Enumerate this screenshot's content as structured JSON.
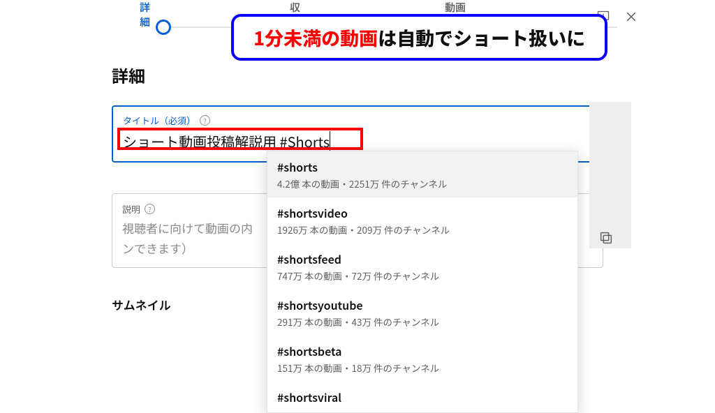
{
  "stepper": {
    "tabs": [
      "詳細",
      "収益化",
      "動画の要素"
    ],
    "active": 0
  },
  "section_title": "詳細",
  "title_field": {
    "label": "タイトル（必須）",
    "value": "ショート動画投稿解説用 #Shorts"
  },
  "description_field": {
    "label": "説明",
    "placeholder_line1": "視聴者に向けて動画の内",
    "placeholder_line2": "ンできます）"
  },
  "subsection": "サムネイル",
  "suggestions": [
    {
      "tag": "#shorts",
      "meta": "4.2億 本の動画・2251万 件のチャンネル"
    },
    {
      "tag": "#shortsvideo",
      "meta": "1926万 本の動画・209万 件のチャンネル"
    },
    {
      "tag": "#shortsfeed",
      "meta": "747万 本の動画・72万 件のチャンネル"
    },
    {
      "tag": "#shortsyoutube",
      "meta": "291万 本の動画・43万 件のチャンネル"
    },
    {
      "tag": "#shortsbeta",
      "meta": "151万 本の動画・18万 件のチャンネル"
    },
    {
      "tag": "#shortsviral",
      "meta": ""
    }
  ],
  "callout": {
    "red": "1分未満の動画",
    "rest": "は自動でショート扱いに"
  }
}
